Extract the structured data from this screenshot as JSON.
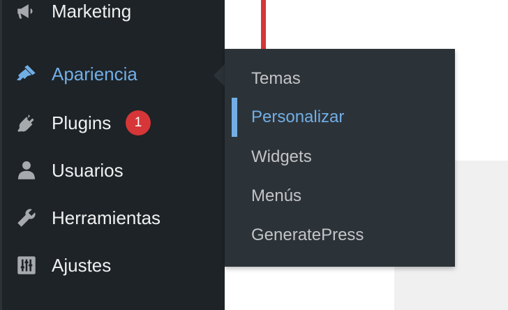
{
  "sidebar": {
    "items": [
      {
        "label": "Marketing",
        "icon": "megaphone-icon",
        "current": false
      },
      {
        "label": "Apariencia",
        "icon": "paintbrush-icon",
        "current": true
      },
      {
        "label": "Plugins",
        "icon": "plugin-icon",
        "current": false,
        "badge": "1"
      },
      {
        "label": "Usuarios",
        "icon": "user-icon",
        "current": false
      },
      {
        "label": "Herramientas",
        "icon": "wrench-icon",
        "current": false
      },
      {
        "label": "Ajustes",
        "icon": "settings-sliders-icon",
        "current": false
      }
    ]
  },
  "flyout": {
    "items": [
      {
        "label": "Temas",
        "current": false
      },
      {
        "label": "Personalizar",
        "current": true
      },
      {
        "label": "Widgets",
        "current": false
      },
      {
        "label": "Menús",
        "current": false
      },
      {
        "label": "GeneratePress",
        "current": false
      }
    ]
  },
  "colors": {
    "sidebar_bg": "#1d2327",
    "flyout_bg": "#2c3338",
    "accent": "#72aee6",
    "badge": "#d63638",
    "text": "#f0f0f1",
    "submenu_text": "#c3c4c7"
  }
}
